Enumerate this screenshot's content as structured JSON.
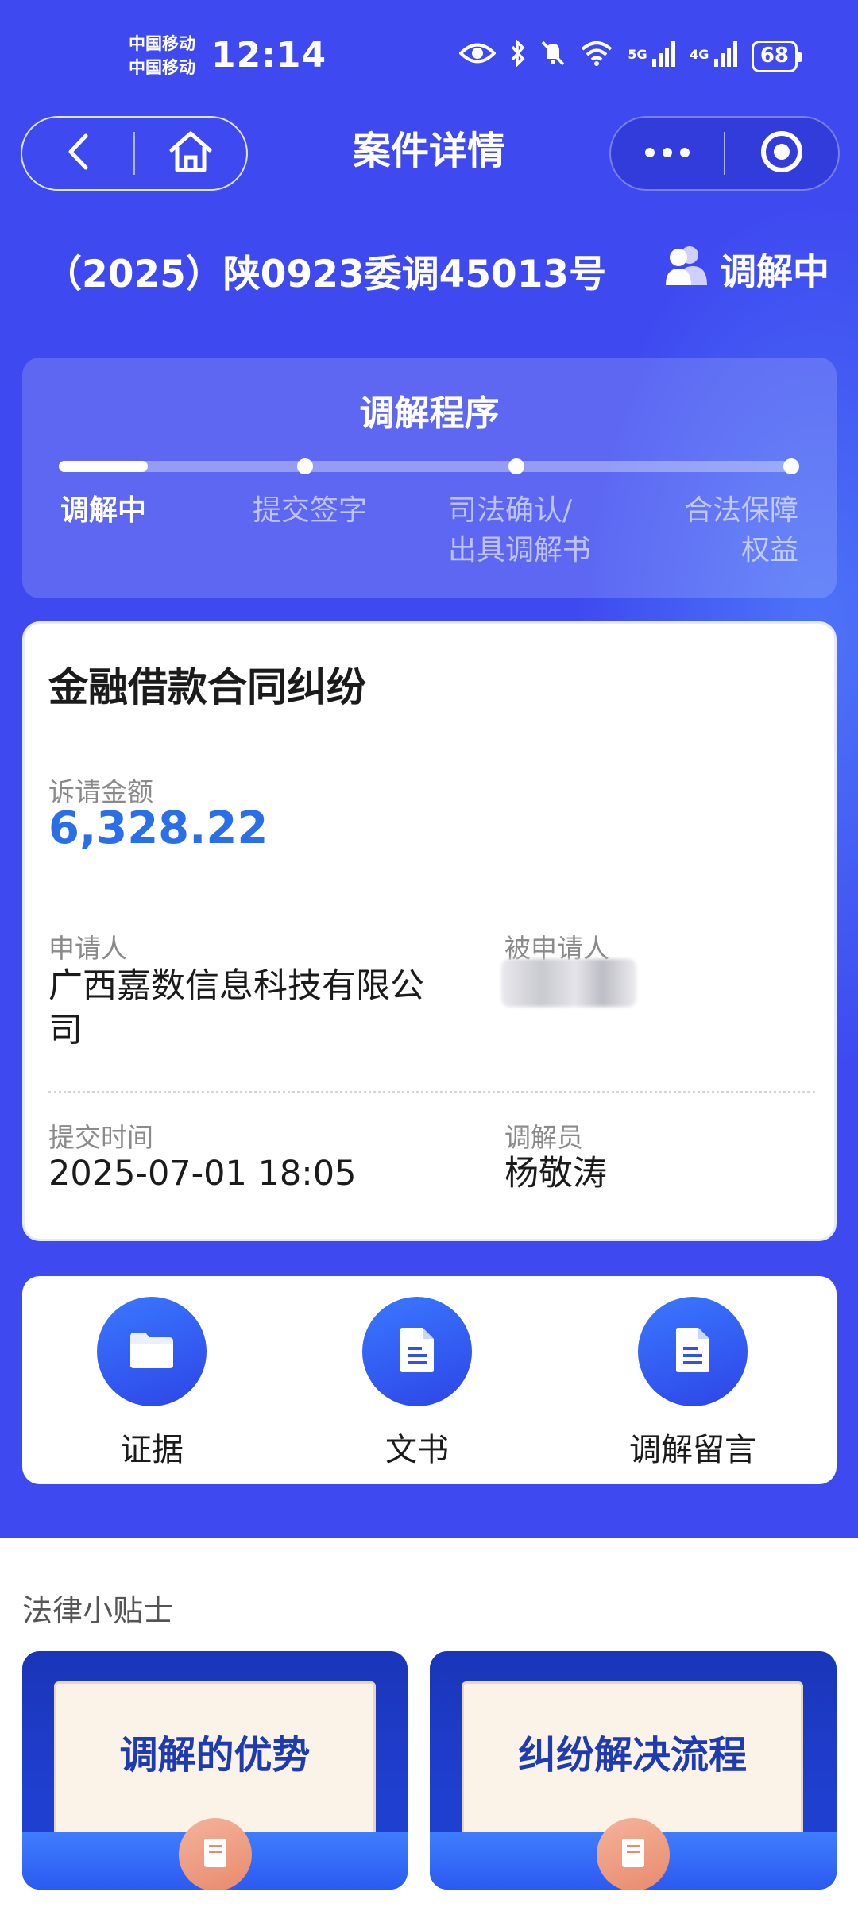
{
  "status_bar": {
    "carrier_1": "中国移动",
    "carrier_2": "中国移动",
    "time": "12:14",
    "net_1": "5G",
    "net_2": "4G",
    "battery": "68"
  },
  "nav": {
    "title": "案件详情",
    "back_icon": "chevron-left-icon",
    "home_icon": "home-icon",
    "more_icon": "more-dots-icon",
    "target_icon": "target-icon"
  },
  "case": {
    "number": "（2025）陕0923委调45013号",
    "status": "调解中",
    "status_icon": "users-icon"
  },
  "procedure": {
    "title": "调解程序",
    "progress": 0.12,
    "steps": [
      {
        "line1": "调解中",
        "line2": ""
      },
      {
        "line1": "提交签字",
        "line2": ""
      },
      {
        "line1": "司法确认/",
        "line2": "出具调解书"
      },
      {
        "line1": "合法保障",
        "line2": "权益"
      }
    ]
  },
  "info": {
    "dispute_type": "金融借款合同纠纷",
    "amount_label": "诉请金额",
    "amount": "6,328.22",
    "applicant_label": "申请人",
    "applicant_line1": "广西嘉数信息科技有限公",
    "applicant_line2": "司",
    "respondent_label": "被申请人",
    "submit_time_label": "提交时间",
    "submit_time": "2025-07-01 18:05",
    "mediator_label": "调解员",
    "mediator": "杨敬涛"
  },
  "actions": [
    {
      "label": "证据",
      "icon": "folder-icon"
    },
    {
      "label": "文书",
      "icon": "document-icon"
    },
    {
      "label": "调解留言",
      "icon": "document-icon"
    }
  ],
  "tips": {
    "title": "法律小贴士",
    "cards": [
      {
        "text": "调解的优势",
        "icon": "book-icon"
      },
      {
        "text": "纠纷解决流程",
        "icon": "book-icon"
      }
    ]
  },
  "colors": {
    "primary": "#3e4af0",
    "amount": "#2a6fe6"
  }
}
